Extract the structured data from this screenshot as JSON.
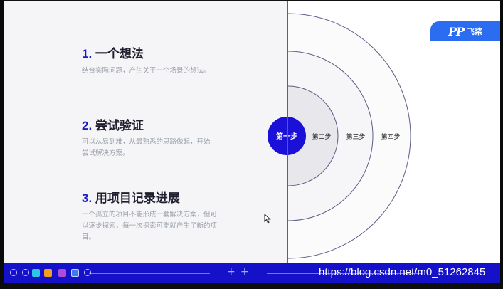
{
  "logo": {
    "mark": "PP",
    "text": "飞桨"
  },
  "steps": [
    {
      "number": "1.",
      "title": "一个想法",
      "desc": [
        "结合实际问题，产生关于一个场景的想法。"
      ]
    },
    {
      "number": "2.",
      "title": "尝试验证",
      "desc": [
        "可以从易到难，从最熟悉的思路做起，开始",
        "尝试解决方案。"
      ]
    },
    {
      "number": "3.",
      "title": "用项目记录进展",
      "desc": [
        "一个孤立的项目不能形成一套解决方案，但可",
        "以逐步探索，每一次探索可能就产生了新的项",
        "目。"
      ]
    }
  ],
  "circles": {
    "labels": [
      "第一步",
      "第二步",
      "第三步",
      "第四步"
    ],
    "colors": {
      "main": "#1a10d8",
      "ring": "#5a5f86",
      "fill1": "#e6e6ea",
      "fill2": "#f0f0f2",
      "fill3": "#f6f6f8",
      "fill4": "#fbfbfc"
    }
  },
  "taskbar": {
    "icons": [
      "prev-icon",
      "next-icon",
      "canvas-icon",
      "pen-icon",
      "marker-icon",
      "screen-icon",
      "zoom-icon"
    ],
    "icon_colors": [
      "#2ec4e8",
      "#f0a020",
      "#b04bd8",
      "#3a7cf0"
    ]
  },
  "watermark": "https://blog.csdn.net/m0_51262845"
}
